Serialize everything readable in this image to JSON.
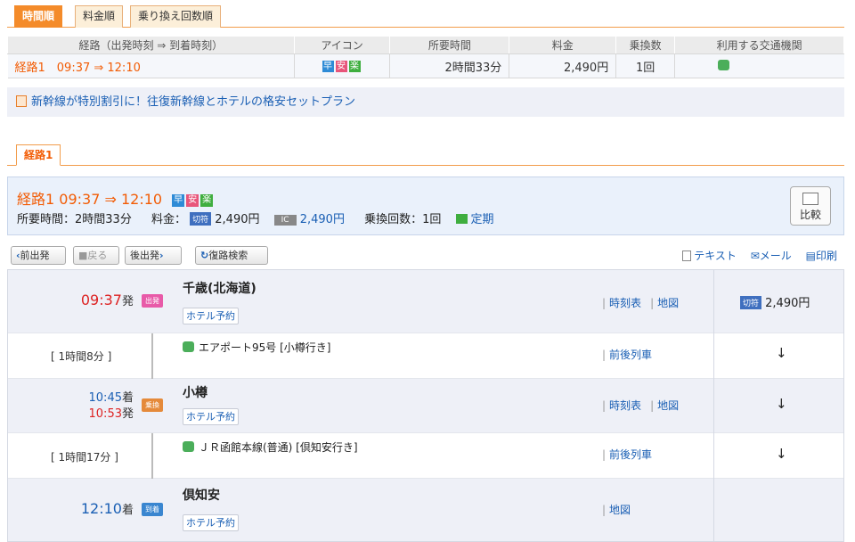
{
  "tabs": {
    "time": "時間順",
    "fare": "料金順",
    "transfers": "乗り換え回数順"
  },
  "summary": {
    "headers": {
      "route": "経路（出発時刻 ⇒ 到着時刻）",
      "icons": "アイコン",
      "duration": "所要時間",
      "fare": "料金",
      "transfers": "乗換数",
      "transport": "利用する交通機関"
    },
    "row": {
      "route": "経路1　09:37 ⇒ 12:10",
      "duration": "2時間33分",
      "fare": "2,490円",
      "transfers": "1回"
    },
    "badges": [
      "早",
      "安",
      "楽"
    ]
  },
  "promo": {
    "text": "新幹線が特別割引に！往復新幹線とホテルの格安セットプラン"
  },
  "route_tab": "経路1",
  "route": {
    "title": "経路1 09:37 ⇒ 12:10",
    "duration_label": "所要時間：2時間33分",
    "fare_label": "料金：",
    "ticket_tag": "切符",
    "ticket_fare": "2,490円",
    "ic_tag": "IC",
    "ic_fare": "2,490円",
    "transfer_label": "乗換回数：1回",
    "teiki": "定期",
    "compare": "比較"
  },
  "toolbar": {
    "prev": "前出発",
    "back": "戻る",
    "next": "後出発",
    "return": "復路検索",
    "text": "テキスト",
    "mail": "メール",
    "print": "印刷"
  },
  "stops": [
    {
      "time": "09:37",
      "label": "発",
      "mark": "出発",
      "name": "千歳(北海道)",
      "hotel": "ホテル予約",
      "link1": "時刻表",
      "link2": "地図",
      "fare_tag": "切符",
      "fare": "2,490円"
    },
    {
      "time_arr": "10:45",
      "label_arr": "着",
      "time_dep": "10:53",
      "label_dep": "発",
      "mark": "乗換",
      "name": "小樽",
      "hotel": "ホテル予約",
      "link1": "時刻表",
      "link2": "地図"
    },
    {
      "time": "12:10",
      "label": "着",
      "mark": "到着",
      "name": "倶知安",
      "hotel": "ホテル予約",
      "link1": "地図"
    }
  ],
  "legs": [
    {
      "duration": "[ 1時間8分 ]",
      "train": "エアポート95号 [小樽行き]",
      "link": "前後列車",
      "arrow": "↓"
    },
    {
      "duration": "[ 1時間17分 ]",
      "train": "ＪＲ函館本線(普通) [倶知安行き]",
      "link": "前後列車",
      "arrow": "↓"
    }
  ],
  "transfer_arrow": "↓"
}
